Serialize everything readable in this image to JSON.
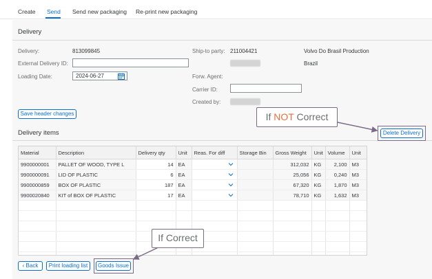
{
  "tabs": [
    {
      "label": "Create",
      "active": false
    },
    {
      "label": "Send",
      "active": true
    },
    {
      "label": "Send new packaging",
      "active": false
    },
    {
      "label": "Re-print new packaging",
      "active": false
    }
  ],
  "delivery_section": {
    "title": "Delivery",
    "delivery_label": "Delivery:",
    "delivery_value": "813099845",
    "external_id_label": "External Delivery ID:",
    "external_id_value": "",
    "loading_date_label": "Loading Date:",
    "loading_date_value": "2024-06-27",
    "ship_to_label": "Ship-to party:",
    "ship_to_value": "211004421",
    "ship_to_name": "Volvo Do Brasil Production",
    "ship_to_country": "Brazil",
    "forw_agent_label": "Forw. Agent:",
    "carrier_id_label": "Carrier ID:",
    "carrier_id_value": "",
    "created_by_label": "Created by:",
    "save_button": "Save header changes"
  },
  "items_section": {
    "title": "Delivery items",
    "delete_button": "Delete Delivery",
    "columns": [
      "Material",
      "Description",
      "Delivery qty",
      "Unit",
      "Reas. For diff",
      "Storage Bin",
      "Gross Weight",
      "Unit",
      "Volume",
      "Unit"
    ],
    "rows": [
      {
        "material": "9900000001",
        "description": "PALLET OF WOOD, TYPE L",
        "qty": "14",
        "unit": "EA",
        "reason": "",
        "storage_bin": "",
        "gross_weight": "312,032",
        "weight_unit": "KG",
        "volume": "2,100",
        "volume_unit": "M3"
      },
      {
        "material": "9900000091",
        "description": "LID OF PLASTIC",
        "qty": "6",
        "unit": "EA",
        "reason": "",
        "storage_bin": "",
        "gross_weight": "25,056",
        "weight_unit": "KG",
        "volume": "0,240",
        "volume_unit": "M3"
      },
      {
        "material": "9900000859",
        "description": "BOX OF PLASTIC",
        "qty": "187",
        "unit": "EA",
        "reason": "",
        "storage_bin": "",
        "gross_weight": "67,320",
        "weight_unit": "KG",
        "volume": "1,870",
        "volume_unit": "M3"
      },
      {
        "material": "9900020840",
        "description": "KIT of BOX OF PLASTIC",
        "qty": "17",
        "unit": "EA",
        "reason": "",
        "storage_bin": "",
        "gross_weight": "78,710",
        "weight_unit": "KG",
        "volume": "1,632",
        "volume_unit": "M3"
      }
    ]
  },
  "footer": {
    "back_button": "Back",
    "print_button": "Print loading list",
    "goods_issue_button": "Goods Issue"
  },
  "annotations": {
    "not_correct_prefix": "If ",
    "not_correct_emph": "NOT",
    "not_correct_suffix": " Correct",
    "correct_text": "If Correct"
  },
  "colors": {
    "accent": "#0a6ed1",
    "annotation_border": "#7b6a85",
    "annotation_emphasis": "#e76e3c"
  }
}
